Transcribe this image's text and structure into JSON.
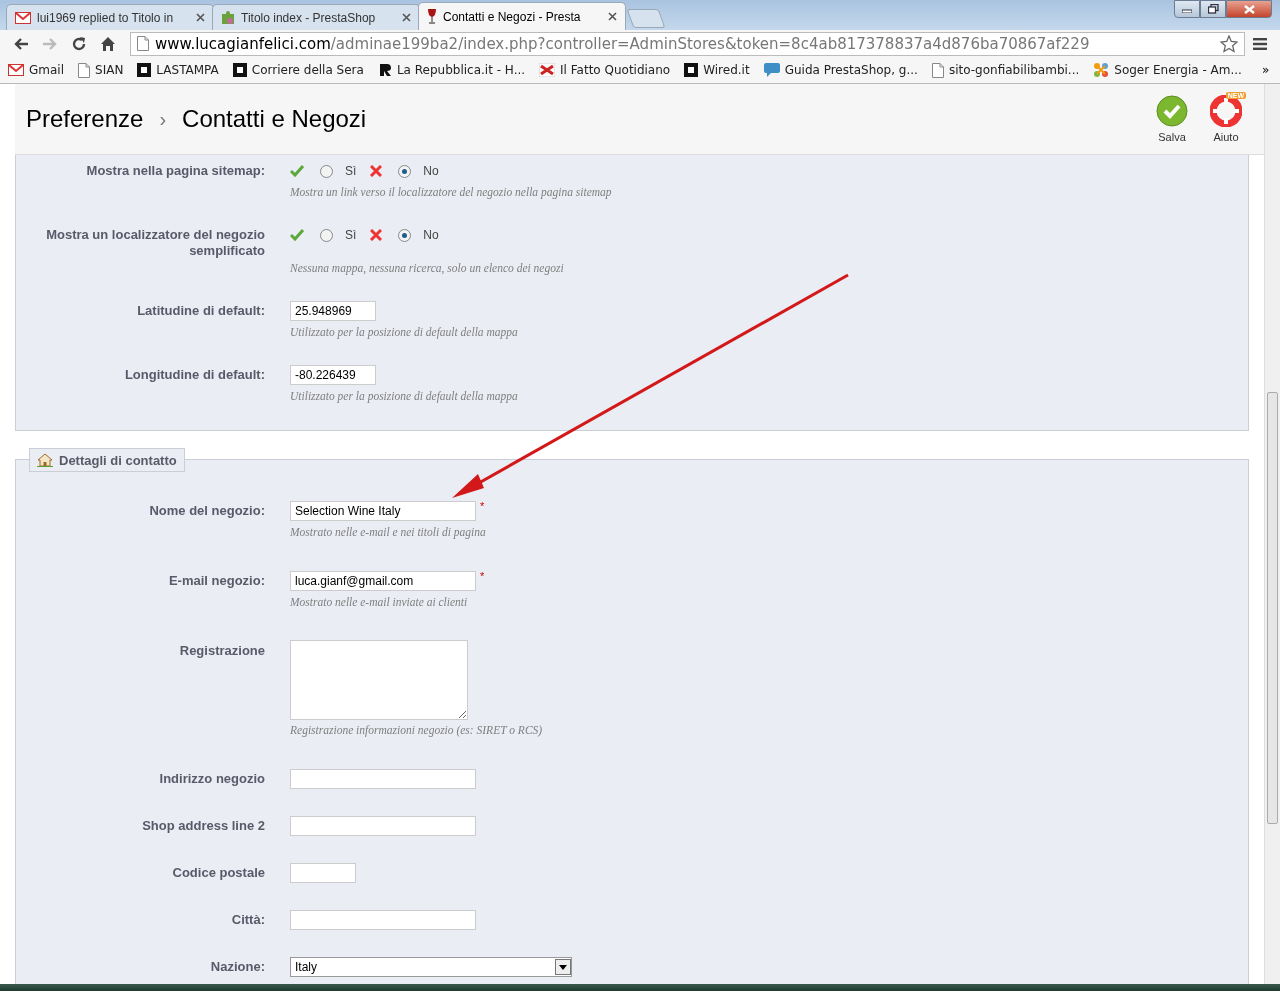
{
  "browser": {
    "tabs": [
      {
        "title": "lui1969 replied to Titolo in",
        "selected": false
      },
      {
        "title": "Titolo index - PrestaShop",
        "selected": false
      },
      {
        "title": "Contatti e Negozi - Presta",
        "selected": true
      }
    ],
    "address": {
      "host": "www.lucagianfelici.com",
      "path": "/adminae199ba2/index.php?controller=AdminStores&token=8c4ab817378837a4d876ba70867af229"
    },
    "bookmarks": [
      {
        "label": "Gmail"
      },
      {
        "label": "SIAN"
      },
      {
        "label": "LASTAMPA"
      },
      {
        "label": "Corriere della Sera"
      },
      {
        "label": "La Repubblica.it - H..."
      },
      {
        "label": "Il Fatto Quotidiano"
      },
      {
        "label": "Wired.it"
      },
      {
        "label": "Guida PrestaShop, g..."
      },
      {
        "label": "sito-gonfiabilibambi..."
      },
      {
        "label": "Soger Energia - Am..."
      }
    ],
    "overflow": "»"
  },
  "header": {
    "breadcrumb": [
      "Preferenze",
      "Contatti e Negozi"
    ],
    "separator": "›",
    "actions": [
      {
        "label": "Salva",
        "kind": "save"
      },
      {
        "label": "Aiuto",
        "kind": "help",
        "badge": "NEW"
      }
    ]
  },
  "sections": [
    {
      "rows": [
        {
          "kind": "toggle",
          "label": "Mostra nella pagina sitemap:",
          "options": [
            {
              "label": "Sì",
              "selected": false
            },
            {
              "label": "No",
              "selected": true
            }
          ],
          "hint": "Mostra un link verso il localizzatore del negozio nella pagina sitemap"
        },
        {
          "kind": "toggle",
          "label": "Mostra un localizzatore del negozio semplificato",
          "options": [
            {
              "label": "Sì",
              "selected": false
            },
            {
              "label": "No",
              "selected": true
            }
          ],
          "hint": "Nessuna mappa, nessuna ricerca, solo un elenco dei negozi"
        },
        {
          "kind": "short-text",
          "label": "Latitudine di default:",
          "value": "25.948969",
          "hint": "Utilizzato per la posizione di default della mappa"
        },
        {
          "kind": "short-text",
          "label": "Longitudine di default:",
          "value": "-80.226439",
          "hint": "Utilizzato per la posizione di default della mappa"
        }
      ]
    },
    {
      "legend": "Dettagli di contatto",
      "rows": [
        {
          "kind": "text",
          "label": "Nome del negozio:",
          "value": "Selection Wine Italy",
          "required_mark": "*",
          "hint": "Mostrato nelle e-mail e nei titoli di pagina"
        },
        {
          "kind": "text",
          "label": "E-mail negozio:",
          "value": "luca.gianf@gmail.com",
          "required_mark": "*",
          "hint": "Mostrato nelle e-mail inviate ai clienti"
        },
        {
          "kind": "textarea",
          "label": "Registrazione",
          "hint": "Registrazione informazioni negozio (es: SIRET o RCS)"
        },
        {
          "kind": "text",
          "label": "Indirizzo negozio"
        },
        {
          "kind": "text",
          "label": "Shop address line 2"
        },
        {
          "kind": "tiny-text",
          "label": "Codice postale"
        },
        {
          "kind": "text",
          "label": "Città:"
        },
        {
          "kind": "select",
          "label": "Nazione:",
          "value": "Italy"
        }
      ]
    }
  ]
}
